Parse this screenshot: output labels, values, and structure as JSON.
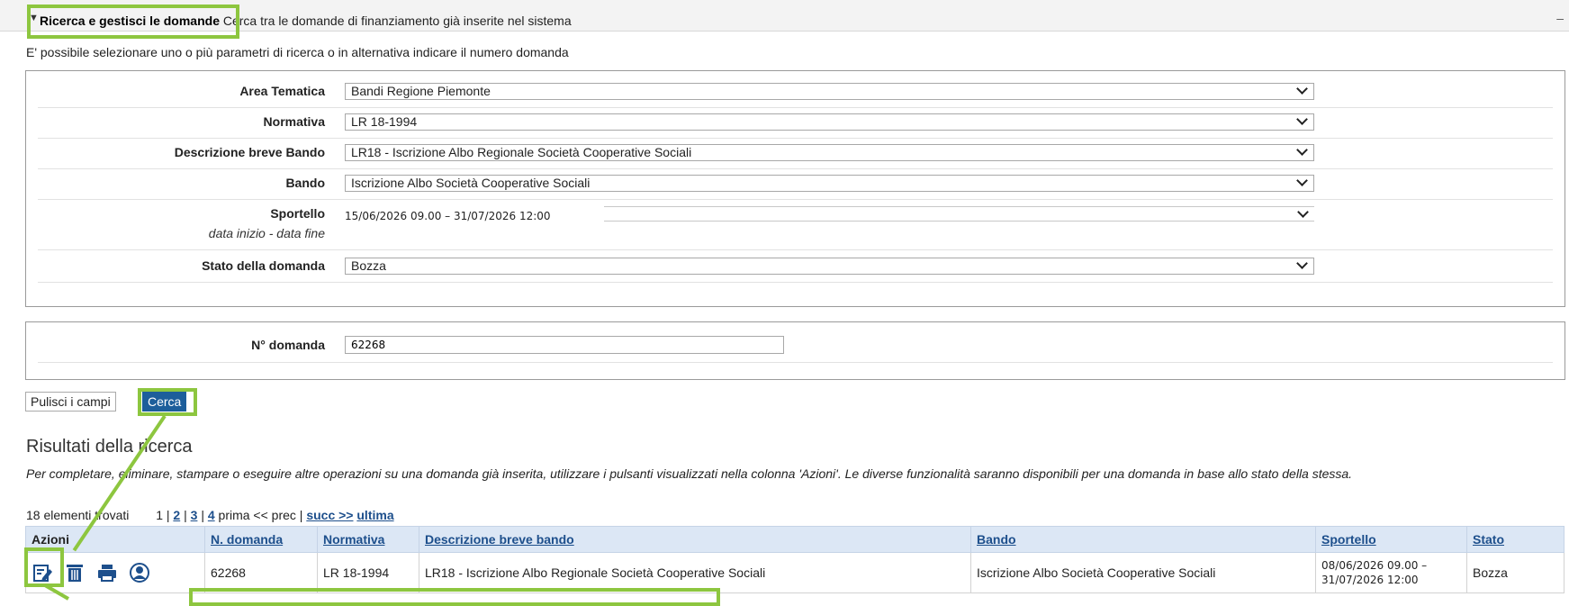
{
  "header": {
    "title_bold": "Ricerca e gestisci le domande",
    "title_rest": "Cerca tra le domande di finanziamento già inserite nel sistema",
    "collapse_glyph": "–"
  },
  "intro": "E' possibile selezionare uno o più parametri di ricerca o in alternativa indicare il numero domanda",
  "search_form": {
    "area_tematica": {
      "label": "Area Tematica",
      "value": "Bandi Regione Piemonte"
    },
    "normativa": {
      "label": "Normativa",
      "value": "LR 18-1994"
    },
    "descrizione_bando": {
      "label": "Descrizione breve Bando",
      "value": "LR18 - Iscrizione Albo Regionale Società Cooperative Sociali"
    },
    "bando": {
      "label": "Bando",
      "value": "Iscrizione Albo Società Cooperative Sociali"
    },
    "sportello": {
      "label": "Sportello",
      "sublabel": "data inizio - data fine",
      "value": "15/06/2026 09.00 – 31/07/2026 12:00"
    },
    "stato": {
      "label": "Stato della domanda",
      "value": "Bozza"
    }
  },
  "numero_form": {
    "label": "N° domanda",
    "value": "62268"
  },
  "buttons": {
    "clear": "Pulisci i campi",
    "search": "Cerca"
  },
  "results": {
    "title": "Risultati della ricerca",
    "note": "Per completare, eliminare, stampare o eseguire altre operazioni su una domanda già inserita, utilizzare i pulsanti visualizzati nella colonna 'Azioni'. Le diverse funzionalità saranno disponibili per una domanda in base allo stato della stessa.",
    "count": "18 elementi trovati",
    "pager": {
      "current": "1",
      "pages": [
        "2",
        "3",
        "4"
      ],
      "prima": "prima <<",
      "prec": "prec",
      "succ": "succ >>",
      "ultima": "ultima"
    },
    "columns": [
      "Azioni",
      "N. domanda",
      "Normativa",
      "Descrizione breve bando",
      "Bando",
      "Sportello",
      "Stato"
    ],
    "rows": [
      {
        "numero": "62268",
        "normativa": "LR 18-1994",
        "descrizione": "LR18 - Iscrizione Albo Regionale Società Cooperative Sociali",
        "bando": "Iscrizione Albo Società Cooperative Sociali",
        "sportello": "08/06/2026 09.00 – 31/07/2026 12:00",
        "stato": "Bozza"
      }
    ],
    "action_icons": [
      "edit-icon",
      "trash-icon",
      "print-icon",
      "user-icon"
    ]
  },
  "colors": {
    "highlight": "#8dc63f",
    "primary_button": "#1d5e9b",
    "table_header": "#dce7f5",
    "link": "#1d4f8c"
  }
}
